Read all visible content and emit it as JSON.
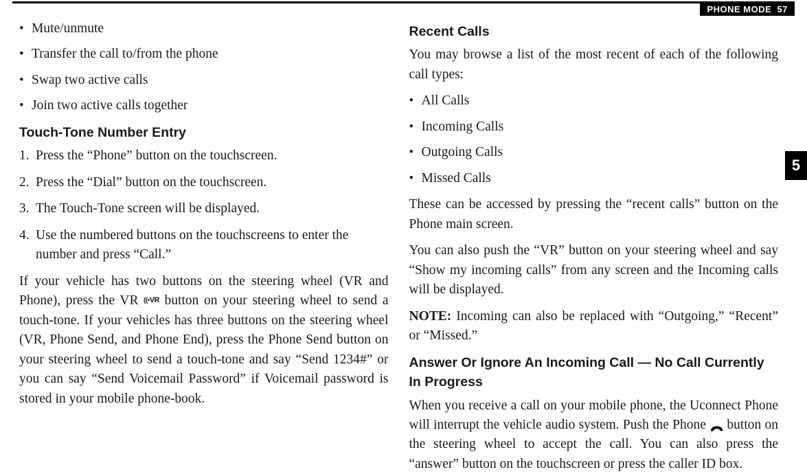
{
  "header": {
    "section": "PHONE MODE",
    "page": "57"
  },
  "tab": "5",
  "left": {
    "bullets1": [
      "Mute/unmute",
      "Transfer the call to/from the phone",
      "Swap two active calls",
      "Join two active calls together"
    ],
    "heading1": "Touch-Tone Number Entry",
    "steps": [
      "Press the “Phone” button on the touchscreen.",
      "Press the “Dial” button on the touchscreen.",
      "The Touch-Tone screen will be displayed.",
      "Use the numbered buttons on the touchscreens to enter the number and press “Call.”"
    ],
    "para1_a": "If your vehicle has two buttons on the steering wheel (VR and Phone), press the VR ",
    "para1_b": " button on your steering wheel to send a touch-tone. If your vehicles has three buttons on the steering wheel (VR, Phone Send, and Phone End), press the Phone Send button on your steering wheel to send a touch-tone and say “Send 1234#” or you can say “Send Voicemail Password” if Voicemail password is stored in your mobile phone-book."
  },
  "right": {
    "heading1": "Recent Calls",
    "para1": "You may browse a list of the most recent of each of the following call types:",
    "bullets": [
      "All Calls",
      "Incoming Calls",
      "Outgoing Calls",
      "Missed Calls"
    ],
    "para2": "These can be accessed by pressing the “recent calls” button on the Phone main screen.",
    "para3": "You can also push the “VR” button on your steering wheel and say “Show my incoming calls” from any screen and the Incoming calls will be displayed.",
    "note_label": "NOTE:",
    "note_text": " Incoming can also be replaced with “Outgoing,” “Recent” or “Missed.”",
    "heading2": "Answer Or Ignore An Incoming Call — No Call Currently In Progress",
    "para4_a": "When you receive a call on your mobile phone, the Uconnect Phone will interrupt the vehicle audio system. Push the Phone ",
    "para4_b": " button on the steering wheel to accept the call. You can also press the “answer” button on the touchscreen or press the caller ID box."
  },
  "icons": {
    "vr": "VR",
    "phone": "phone"
  }
}
